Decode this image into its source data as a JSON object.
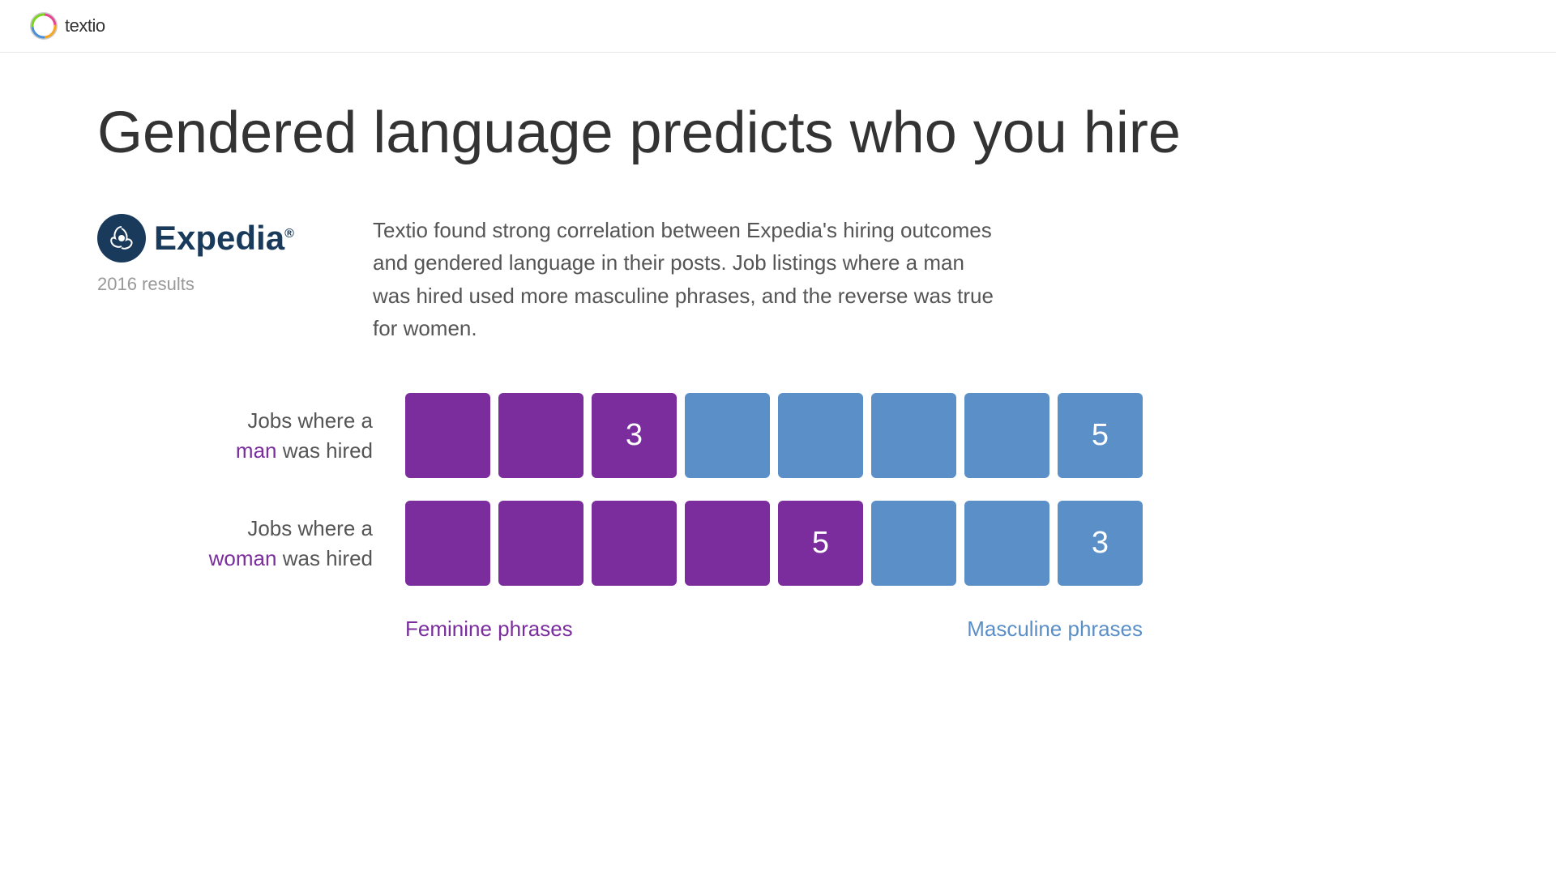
{
  "navbar": {
    "logo_text": "textio"
  },
  "page": {
    "title": "Gendered language predicts who you hire"
  },
  "brand": {
    "name": "Expedia",
    "reg_symbol": "®",
    "results_label": "2016 results"
  },
  "description": {
    "text": "Textio found strong correlation between Expedia's hiring outcomes and gendered language in their posts. Job listings where a man was hired used more masculine phrases, and the reverse was true for women."
  },
  "chart": {
    "row_man_label_pre": "Jobs where a",
    "row_man_highlight": "man",
    "row_man_label_post": "was hired",
    "row_woman_label_pre": "Jobs where a",
    "row_woman_highlight": "woman",
    "row_woman_label_post": "was hired",
    "man_row": [
      {
        "type": "purple",
        "value": ""
      },
      {
        "type": "purple",
        "value": ""
      },
      {
        "type": "purple",
        "value": "3"
      },
      {
        "type": "blue",
        "value": ""
      },
      {
        "type": "blue",
        "value": ""
      },
      {
        "type": "blue",
        "value": ""
      },
      {
        "type": "blue",
        "value": ""
      },
      {
        "type": "blue",
        "value": "5"
      }
    ],
    "woman_row": [
      {
        "type": "purple",
        "value": ""
      },
      {
        "type": "purple",
        "value": ""
      },
      {
        "type": "purple",
        "value": ""
      },
      {
        "type": "purple",
        "value": ""
      },
      {
        "type": "purple",
        "value": "5"
      },
      {
        "type": "blue",
        "value": ""
      },
      {
        "type": "blue",
        "value": ""
      },
      {
        "type": "blue",
        "value": "3"
      }
    ],
    "feminine_label": "Feminine phrases",
    "masculine_label": "Masculine phrases"
  }
}
